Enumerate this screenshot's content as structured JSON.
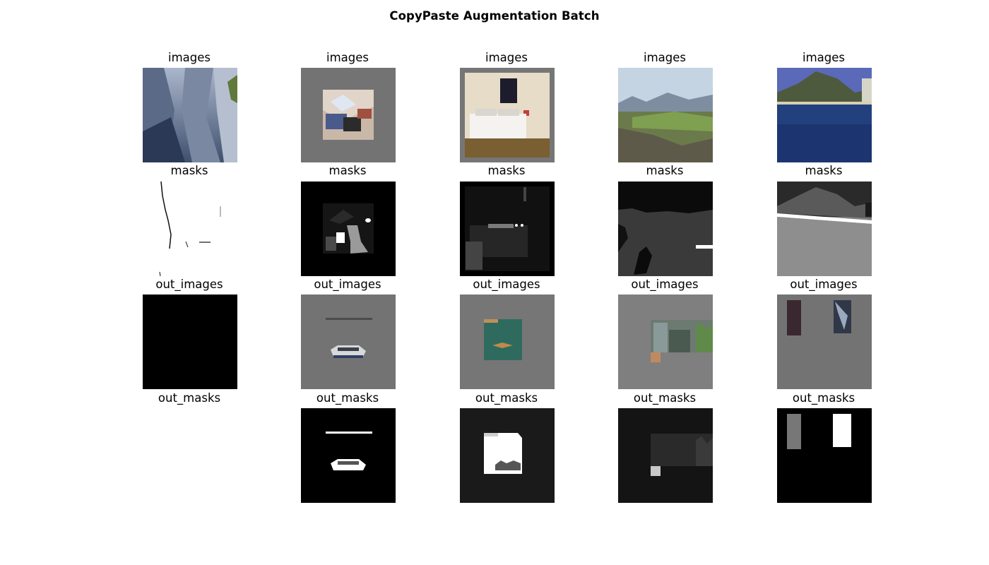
{
  "title": "CopyPaste Augmentation Batch",
  "row_labels": [
    "images",
    "masks",
    "out_images",
    "out_masks"
  ],
  "grid": [
    [
      {
        "row": "images",
        "thumb": "canyon-cliffs"
      },
      {
        "row": "images",
        "thumb": "attic-desk-room"
      },
      {
        "row": "images",
        "thumb": "bedroom"
      },
      {
        "row": "images",
        "thumb": "grassland-valley"
      },
      {
        "row": "images",
        "thumb": "coastal-mountain-bay"
      }
    ],
    [
      {
        "row": "masks",
        "thumb": "sparse-white-mask"
      },
      {
        "row": "masks",
        "thumb": "desk-room-mask"
      },
      {
        "row": "masks",
        "thumb": "bedroom-mask"
      },
      {
        "row": "masks",
        "thumb": "valley-mask"
      },
      {
        "row": "masks",
        "thumb": "bay-mask"
      }
    ],
    [
      {
        "row": "out_images",
        "thumb": "black"
      },
      {
        "row": "out_images",
        "thumb": "gray-with-paste-vehicle"
      },
      {
        "row": "out_images",
        "thumb": "gray-with-paste-green-patch"
      },
      {
        "row": "out_images",
        "thumb": "gray-with-paste-building"
      },
      {
        "row": "out_images",
        "thumb": "gray-with-paste-curtain-panel"
      }
    ],
    [
      {
        "row": "out_masks",
        "thumb": "empty"
      },
      {
        "row": "out_masks",
        "thumb": "vehicle-mask"
      },
      {
        "row": "out_masks",
        "thumb": "white-patch-mask"
      },
      {
        "row": "out_masks",
        "thumb": "building-mask"
      },
      {
        "row": "out_masks",
        "thumb": "curtain-panel-mask"
      }
    ]
  ]
}
